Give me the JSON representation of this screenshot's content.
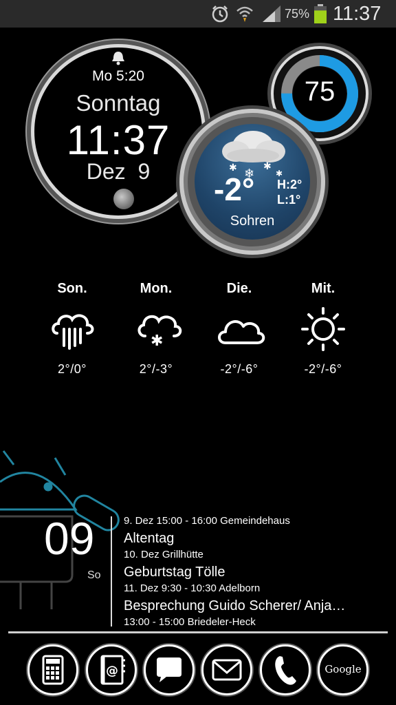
{
  "status_bar": {
    "battery_percent": "75%",
    "battery_level": 0.75,
    "time": "11:37",
    "icons": [
      "alarm-icon",
      "wifi-icon",
      "signal-icon",
      "battery-icon"
    ]
  },
  "clock": {
    "alarm": "Mo 5:20",
    "weekday": "Sonntag",
    "time": "11:37",
    "month": "Dez",
    "day": "9",
    "icons": [
      "alarm-bell-icon",
      "moon-phase-icon"
    ]
  },
  "battery_widget": {
    "value": "75",
    "level": 0.75,
    "accent": "#1e9be3"
  },
  "weather": {
    "temp": "-2°",
    "high": "H:2°",
    "low": "L:1°",
    "location": "Sohren",
    "icon": "snow-cloud-icon"
  },
  "forecast": [
    {
      "day": "Son.",
      "temp": "2°/0°",
      "icon": "rain-cloud-icon"
    },
    {
      "day": "Mon.",
      "temp": "2°/-3°",
      "icon": "snow-cloud-icon"
    },
    {
      "day": "Die.",
      "temp": "-2°/-6°",
      "icon": "cloud-icon"
    },
    {
      "day": "Mit.",
      "temp": "-2°/-6°",
      "icon": "sun-icon"
    }
  ],
  "calendar": {
    "day_number": "09",
    "weekday": "So",
    "events": [
      {
        "meta": "9. Dez   15:00 - 16:00   Gemeindehaus",
        "title": "Altentag"
      },
      {
        "meta": "10. Dez   Grillhütte",
        "title": "Geburtstag Tölle"
      },
      {
        "meta": "11. Dez   9:30 - 10:30   Adelborn",
        "title": "Besprechung Guido Scherer/ Anja…"
      },
      {
        "meta": "13:00 - 15:00   Briedeler-Heck",
        "title": ""
      }
    ]
  },
  "dock": {
    "items": [
      "calculator-icon",
      "contacts-icon",
      "messaging-icon",
      "email-icon",
      "phone-icon",
      "google-icon"
    ],
    "google_label": "Google"
  },
  "colors": {
    "android_outline": "#2aa7c9",
    "battery_accent": "#1e9be3",
    "battery_green": "#9fd21a"
  }
}
